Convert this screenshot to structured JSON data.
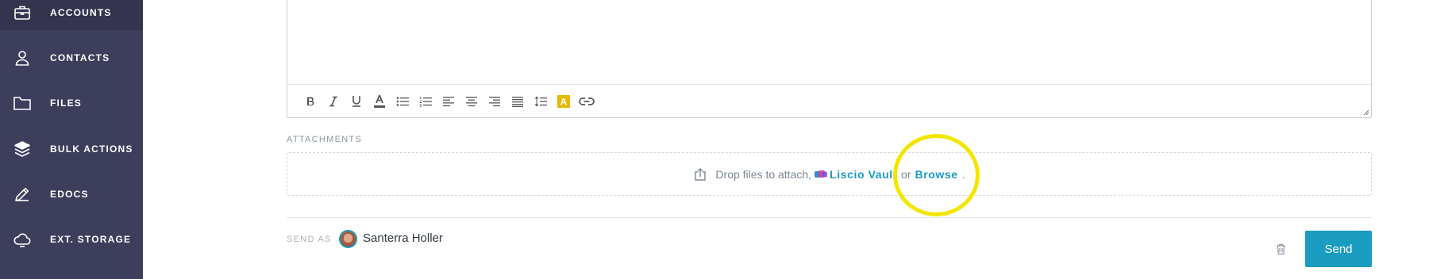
{
  "sidebar": {
    "items": [
      {
        "label": "ACCOUNTS",
        "icon": "briefcase-icon"
      },
      {
        "label": "CONTACTS",
        "icon": "person-icon"
      },
      {
        "label": "FILES",
        "icon": "folder-icon"
      },
      {
        "label": "BULK ACTIONS",
        "icon": "layers-icon"
      },
      {
        "label": "EDOCS",
        "icon": "pen-icon"
      },
      {
        "label": "EXT. STORAGE",
        "icon": "cloud-icon"
      }
    ]
  },
  "toolbar": {
    "buttons": [
      "bold-icon",
      "italic-icon",
      "underline-icon",
      "font-color-icon",
      "bullet-list-icon",
      "numbered-list-icon",
      "align-left-icon",
      "align-center-icon",
      "align-right-icon",
      "justify-icon",
      "line-height-icon",
      "highlight-color-icon",
      "link-icon"
    ],
    "highlight_letter": "A"
  },
  "attachments": {
    "label": "ATTACHMENTS",
    "drop_text": "Drop files to attach,",
    "vault_link": "Liscio Vault",
    "or_text": "or",
    "browse_link": "Browse",
    "end_text": "."
  },
  "send_as": {
    "label": "SEND AS",
    "name": "Santerra Holler"
  },
  "actions": {
    "send_label": "Send"
  },
  "colors": {
    "sidebar": "#3d3d5c",
    "accent": "#1a9bc0",
    "highlight_circle": "#f2e600"
  }
}
